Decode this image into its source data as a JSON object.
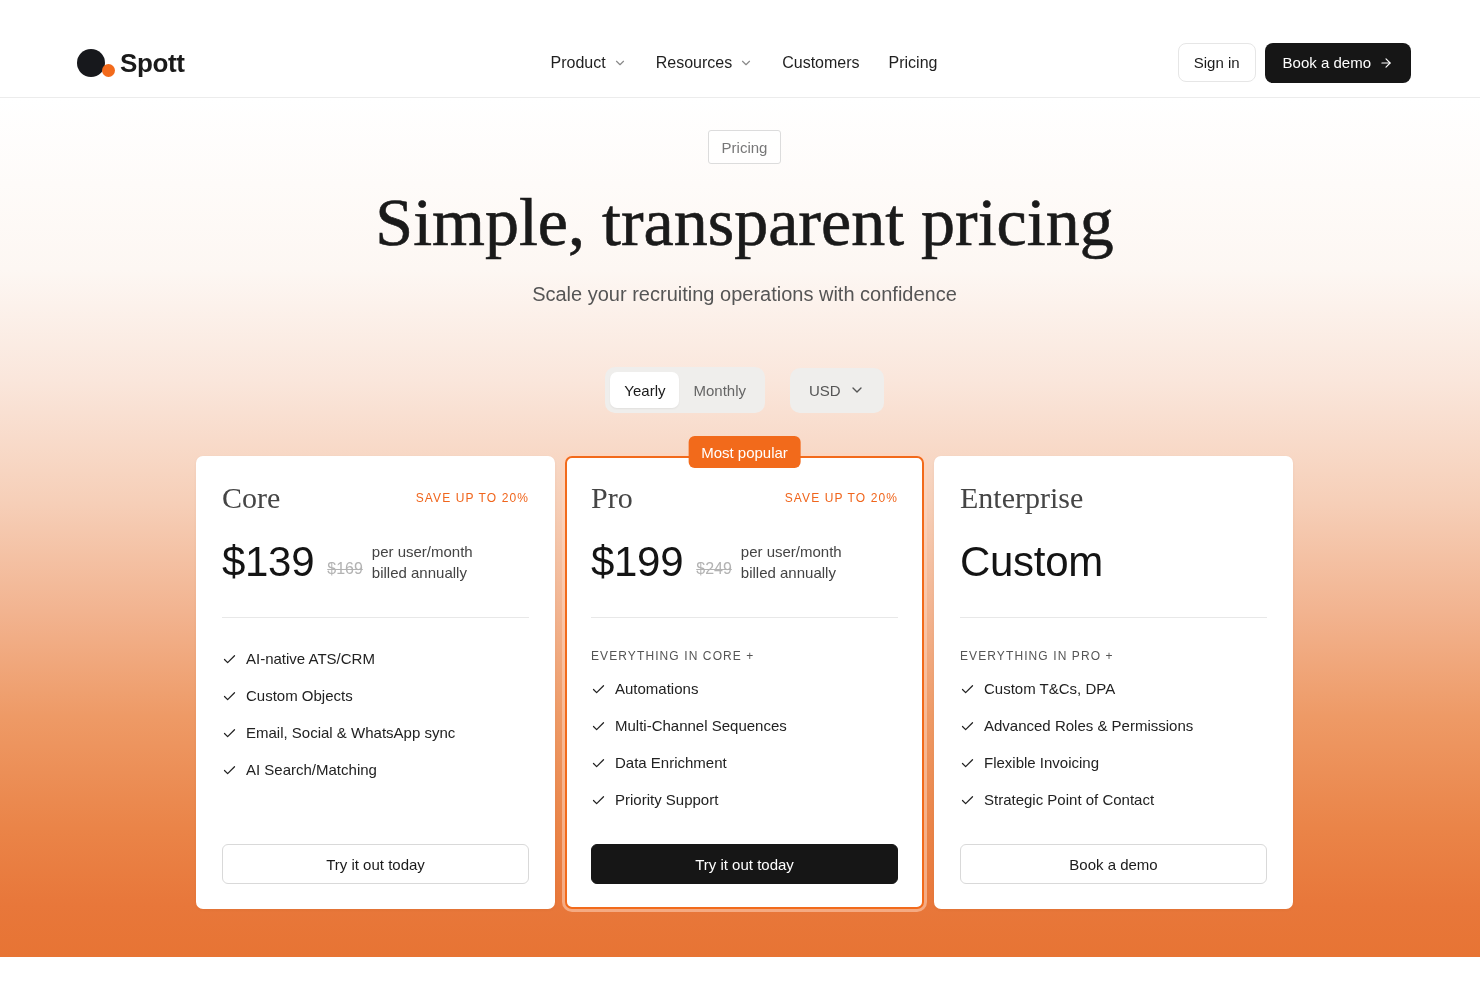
{
  "header": {
    "logo_text": "Spott",
    "nav": [
      {
        "label": "Product",
        "dropdown": true
      },
      {
        "label": "Resources",
        "dropdown": true
      },
      {
        "label": "Customers",
        "dropdown": false
      },
      {
        "label": "Pricing",
        "dropdown": false
      }
    ],
    "sign_in": "Sign in",
    "book_demo": "Book a demo"
  },
  "hero": {
    "badge": "Pricing",
    "title": "Simple, transparent pricing",
    "subtitle": "Scale your recruiting operations with confidence"
  },
  "billing_toggle": [
    {
      "label": "Yearly",
      "selected": true
    },
    {
      "label": "Monthly",
      "selected": false
    }
  ],
  "currency": "USD",
  "plans": [
    {
      "name": "Core",
      "featured": false,
      "save_label": "SAVE UP TO 20%",
      "price": "$139",
      "old_price": "$169",
      "unit": "per user/month",
      "billing": "billed annually",
      "features": [
        "AI-native ATS/CRM",
        "Custom Objects",
        "Email, Social & WhatsApp sync",
        "AI Search/Matching"
      ],
      "cta": {
        "label": "Try it out today",
        "kind": "outline"
      }
    },
    {
      "name": "Pro",
      "featured": true,
      "badge": "Most popular",
      "save_label": "SAVE UP TO 20%",
      "price": "$199",
      "old_price": "$249",
      "unit": "per user/month",
      "billing": "billed annually",
      "features_heading": "EVERYTHING IN CORE +",
      "features": [
        "Automations",
        "Multi-Channel Sequences",
        "Data Enrichment",
        "Priority Support"
      ],
      "cta": {
        "label": "Try it out today",
        "kind": "solid"
      }
    },
    {
      "name": "Enterprise",
      "featured": false,
      "price": "Custom",
      "features_heading": "EVERYTHING IN PRO +",
      "features": [
        "Custom T&Cs, DPA",
        "Advanced Roles & Permissions",
        "Flexible Invoicing",
        "Strategic Point of Contact"
      ],
      "cta": {
        "label": "Book a demo",
        "kind": "outline"
      }
    }
  ]
}
